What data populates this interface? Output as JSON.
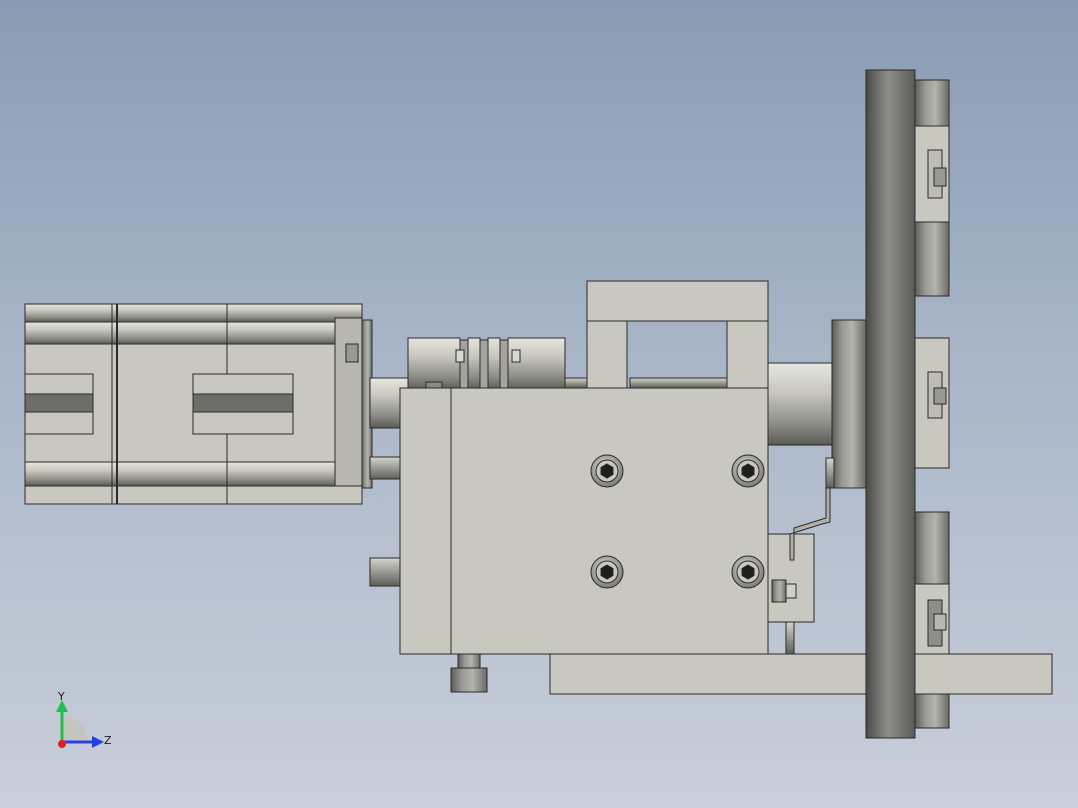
{
  "view": {
    "background_top": "#8a9bb3",
    "background_bottom": "#c9cfda",
    "part_fill": "#c8c8c0",
    "part_shade": "#9a9a94",
    "edge_color": "#2a2a2a"
  },
  "triad": {
    "y_label": "Y",
    "z_label": "Z",
    "y_color": "#22c04a",
    "z_color": "#2a3fe0",
    "x_color": "#e02020"
  }
}
